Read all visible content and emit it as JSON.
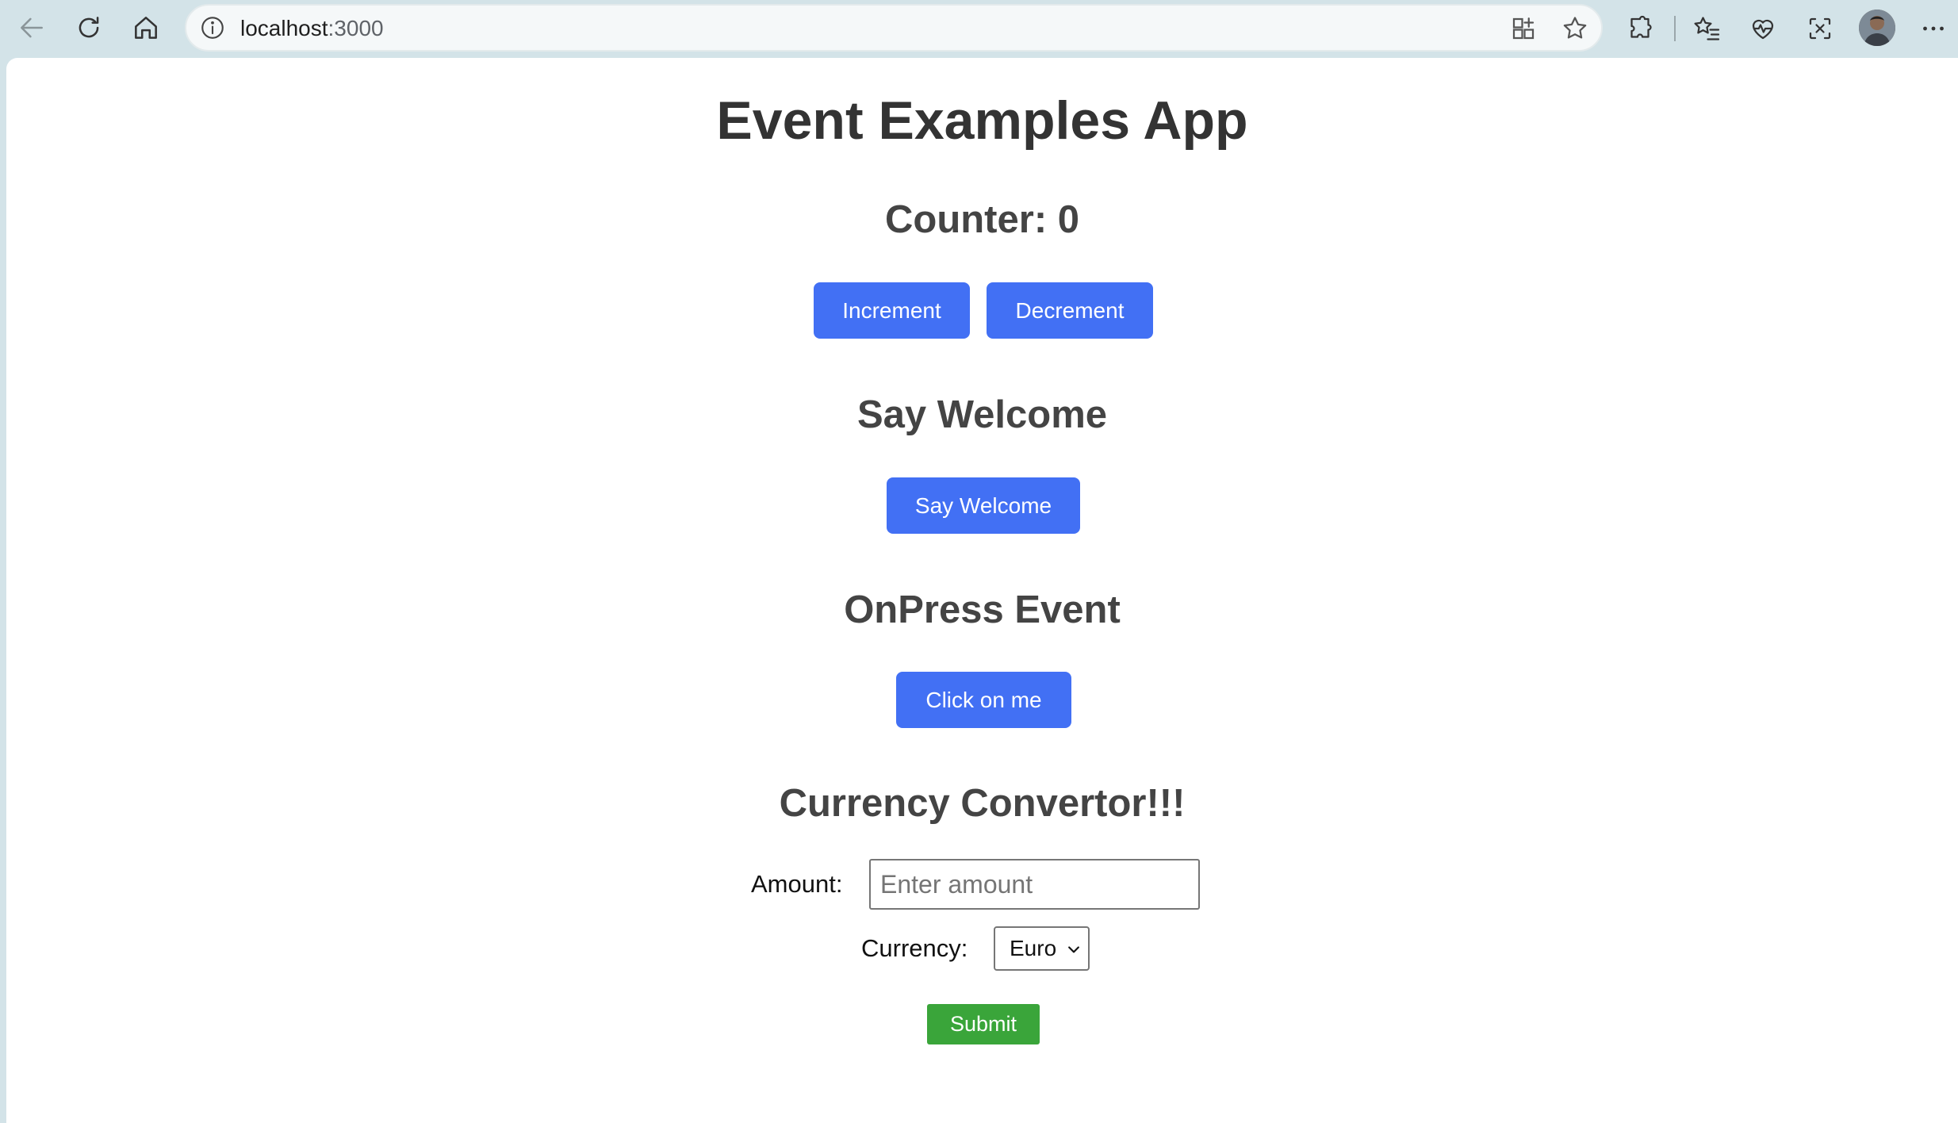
{
  "browser": {
    "url_host": "localhost",
    "url_port": ":3000"
  },
  "app": {
    "title": "Event Examples App"
  },
  "counter": {
    "heading": "Counter: 0",
    "increment_label": "Increment",
    "decrement_label": "Decrement"
  },
  "welcome": {
    "heading": "Say Welcome",
    "button_label": "Say Welcome"
  },
  "onpress": {
    "heading": "OnPress Event",
    "button_label": "Click on me"
  },
  "currency": {
    "heading": "Currency Convertor!!!",
    "amount_label": "Amount:",
    "amount_placeholder": "Enter amount",
    "amount_value": "",
    "currency_label": "Currency:",
    "currency_selected": "Euro",
    "submit_label": "Submit"
  },
  "colors": {
    "primary_button": "#4270f4",
    "submit_button": "#3aa53a",
    "chrome_bg": "#d3e3e8"
  }
}
